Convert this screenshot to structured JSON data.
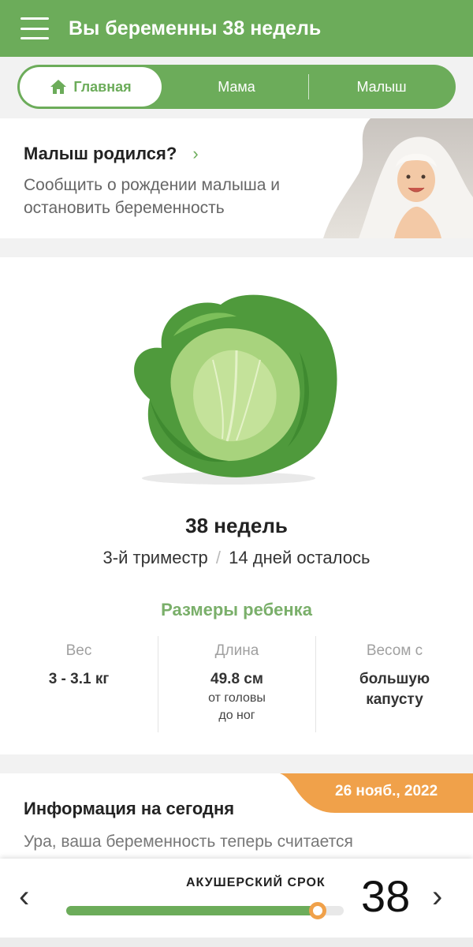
{
  "header": {
    "title": "Вы беременны 38 недель",
    "menu_icon": "hamburger-menu-icon"
  },
  "tabs": {
    "home": "Главная",
    "mama": "Мама",
    "baby": "Малыш",
    "active": "home",
    "home_icon": "home-icon"
  },
  "born_card": {
    "title": "Малыш родился?",
    "chevron": "›",
    "subtitle": "Сообщить о рождении малыша и остановить беременность"
  },
  "week": {
    "weeks_title": "38 недель",
    "trimester": "3-й триместр",
    "separator": "/",
    "days_left": "14 дней осталось",
    "sizes_title": "Размеры ребенка",
    "stats": [
      {
        "label": "Вес",
        "value": "3 - 3.1 кг",
        "note1": "",
        "note2": ""
      },
      {
        "label": "Длина",
        "value": "49.8 см",
        "note1": "от головы",
        "note2": "до ног"
      },
      {
        "label": "Весом с",
        "value": "большую",
        "value2": "капусту"
      }
    ]
  },
  "info": {
    "date": "26 нояб., 2022",
    "title": "Информация на сегодня",
    "text": "Ура, ваша беременность теперь считается"
  },
  "bottom": {
    "label": "АКУШЕРСКИЙ СРОК",
    "week_number": "38",
    "progress": 0.905,
    "prev": "‹",
    "next": "›"
  },
  "colors": {
    "accent": "#6cac5a",
    "badge": "#f0a14a"
  }
}
